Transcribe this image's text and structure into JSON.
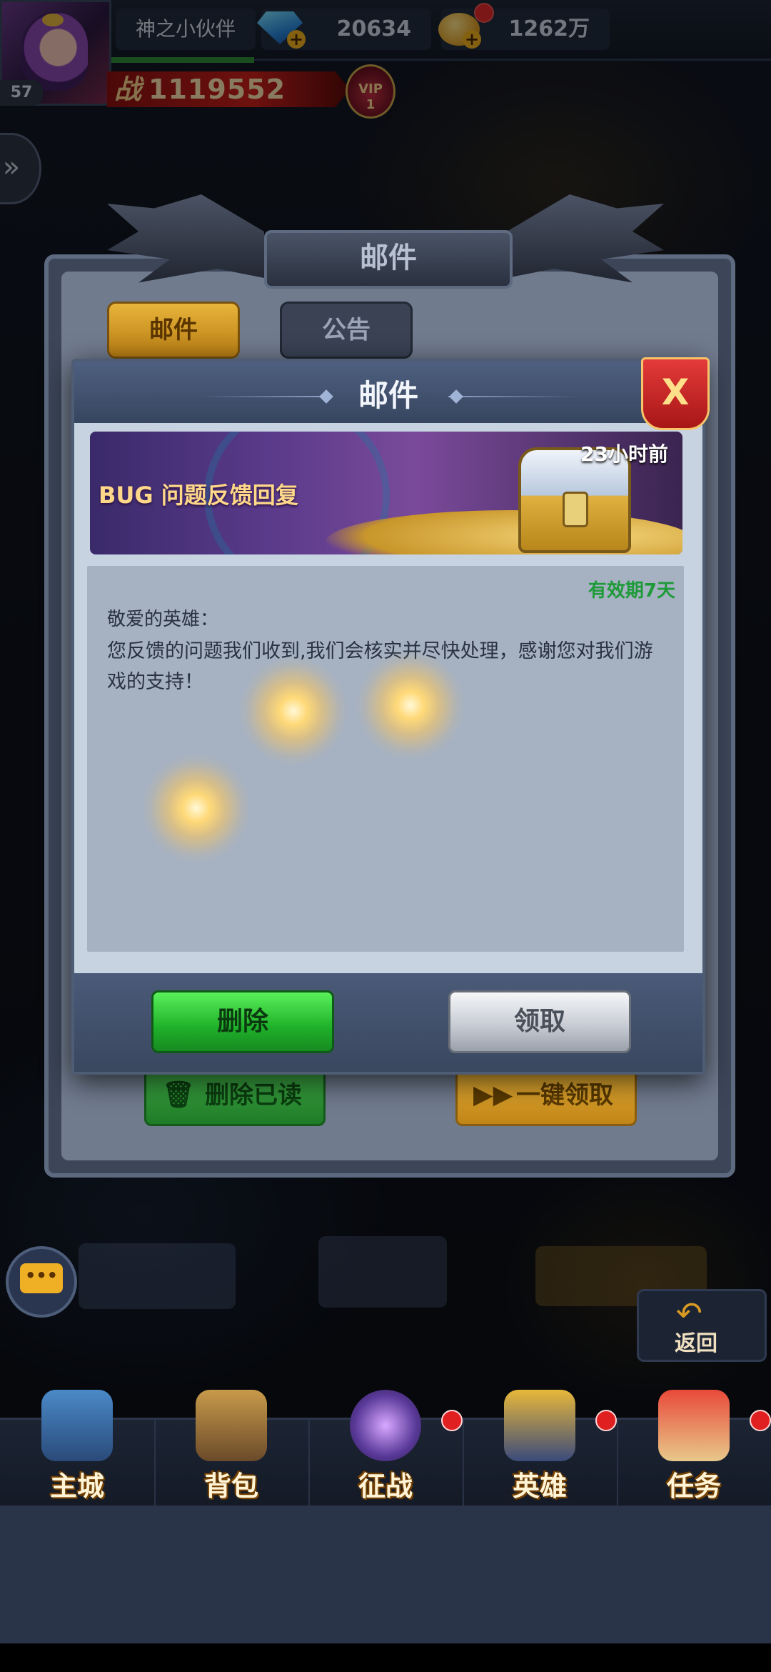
{
  "hud": {
    "player_name": "神之小伙伴",
    "level": "57",
    "gems": "20634",
    "gold": "1262万",
    "power_label": "战",
    "power": "1119552",
    "vip_label": "VIP",
    "vip_level": "1",
    "plus": "+"
  },
  "outer_panel": {
    "title": "邮件",
    "tabs": [
      "邮件",
      "公告"
    ],
    "delete_read_label": "删除已读",
    "claim_all_label": "一键领取"
  },
  "dialog": {
    "title": "邮件",
    "close_label": "X",
    "banner_title": "BUG 问题反馈回复",
    "time_ago": "23小时前",
    "expiry": "有效期7天",
    "greeting": "敬爱的英雄：",
    "content": "您反馈的问题我们收到,我们会核实并尽快处理，感谢您对我们游戏的支持！",
    "delete_label": "删除",
    "claim_label": "领取"
  },
  "side": {
    "back_label": "返回",
    "chat_icon": "•••"
  },
  "nav": {
    "items": [
      {
        "label": "主城",
        "icon": "castle-icon",
        "badge": false
      },
      {
        "label": "背包",
        "icon": "backpack-icon",
        "badge": false
      },
      {
        "label": "征战",
        "icon": "battle-icon",
        "badge": true
      },
      {
        "label": "英雄",
        "icon": "hero-helmet-icon",
        "badge": true
      },
      {
        "label": "任务",
        "icon": "quest-scroll-icon",
        "badge": true
      }
    ]
  },
  "colors": {
    "accent_gold": "#f0b020",
    "delete_green": "#1fb02a",
    "close_red": "#c82020",
    "expiry_green": "#1f9a3a"
  }
}
